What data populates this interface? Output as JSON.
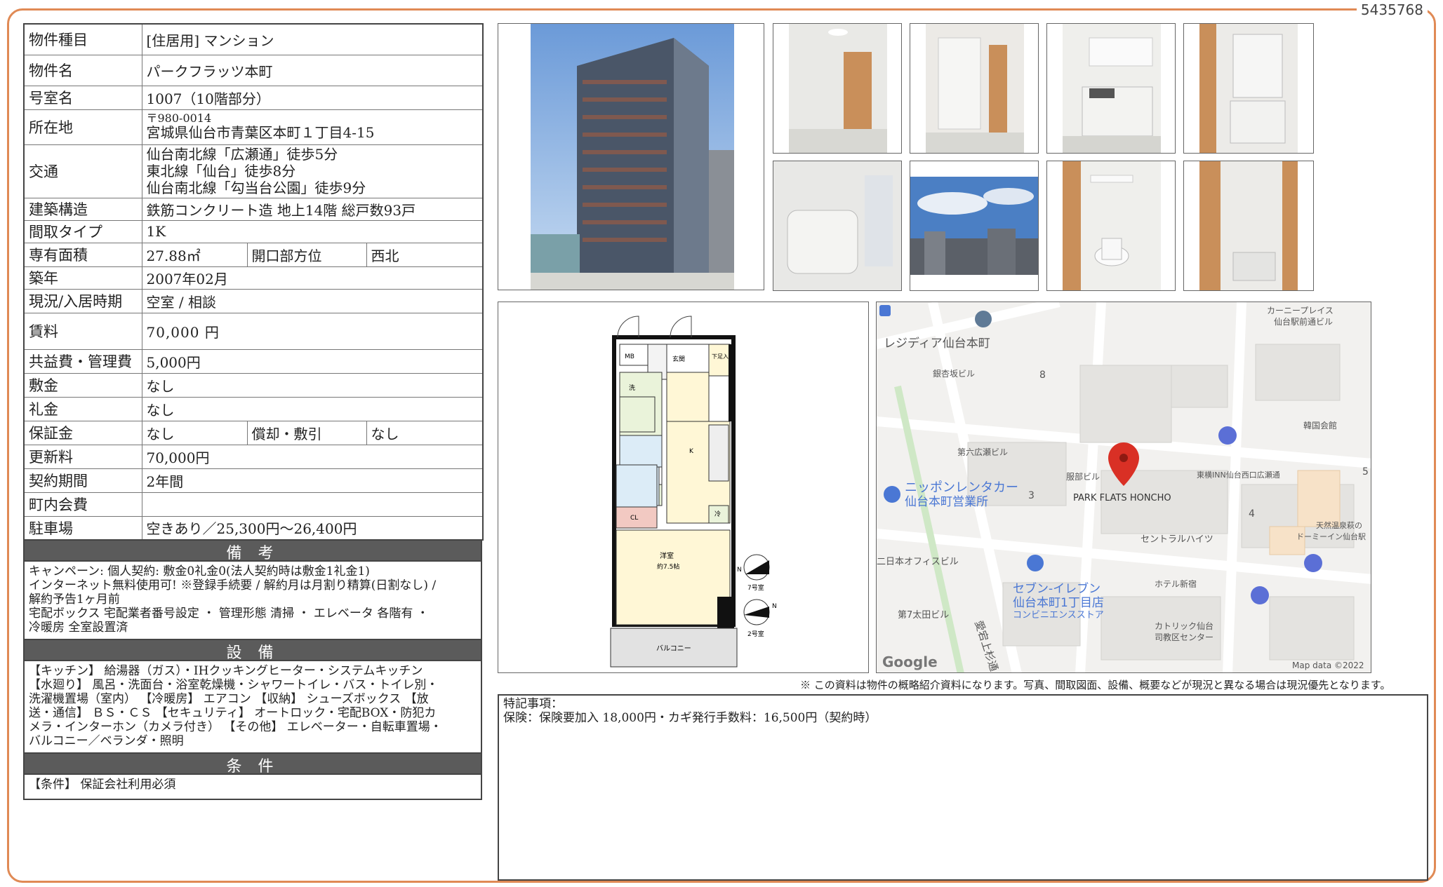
{
  "doc_number": "5435768",
  "spec": {
    "type_label": "物件種目",
    "type_value": "[住居用] マンション",
    "name_label": "物件名",
    "name_value": "パークフラッツ本町",
    "room_label": "号室名",
    "room_value": "1007（10階部分）",
    "address_label": "所在地",
    "postal": "〒980-0014",
    "address_value": "宮城県仙台市青葉区本町１丁目4-15",
    "traffic_label": "交通",
    "traffic_lines": [
      "仙台南北線「広瀬通」徒歩5分",
      "東北線「仙台」徒歩8分",
      "仙台南北線「勾当台公園」徒歩9分"
    ],
    "structure_label": "建築構造",
    "structure_value": "鉄筋コンクリート造 地上14階 総戸数93戸",
    "layout_label": "間取タイプ",
    "layout_value": "1K",
    "area_label": "専有面積",
    "area_value": "27.88㎡",
    "direction_label": "開口部方位",
    "direction_value": "西北",
    "built_label": "築年",
    "built_value": "2007年02月",
    "status_label": "現況/入居時期",
    "status_value": "空室 / 相談",
    "rent_label": "賃料",
    "rent_value": "70,000 円",
    "fee_label": "共益費・管理費",
    "fee_value": "5,000円",
    "deposit_label": "敷金",
    "deposit_value": "なし",
    "keymoney_label": "礼金",
    "keymoney_value": "なし",
    "guarantee_label": "保証金",
    "guarantee_value": "なし",
    "amort_label": "償却・敷引",
    "amort_value": "なし",
    "renewal_label": "更新料",
    "renewal_value": "70,000円",
    "term_label": "契約期間",
    "term_value": "2年間",
    "townfee_label": "町内会費",
    "townfee_value": "",
    "parking_label": "駐車場",
    "parking_value": "空きあり／25,300円〜26,400円"
  },
  "remarks": {
    "title": "備 考",
    "lines": [
      "キャンペーン: 個人契約: 敷金0礼金0(法人契約時は敷金1礼金1)",
      "インターネット無料使用可! ※登録手続要 / 解約月は月割り精算(日割なし) /",
      "解約予告1ヶ月前",
      "宅配ボックス 宅配業者番号設定 ・ 管理形態 清掃 ・ エレベータ 各階有 ・",
      "冷暖房 全室設置済"
    ]
  },
  "equipment": {
    "title": "設 備",
    "lines": [
      "【キッチン】 給湯器（ガス）・IHクッキングヒーター・システムキッチン",
      "【水廻り】 風呂・洗面台・浴室乾燥機・シャワートイレ・バス・トイレ別・",
      "洗濯機置場（室内） 【冷暖房】 エアコン 【収納】 シューズボックス 【放",
      "送・通信】 ＢＳ・ＣＳ 【セキュリティ】 オートロック・宅配BOX・防犯カ",
      "メラ・インターホン（カメラ付き） 【その他】 エレベーター・自転車置場・",
      "バルコニー／ベランダ・照明"
    ]
  },
  "conditions": {
    "title": "条 件",
    "text": "【条件】 保証会社利用必須"
  },
  "floorplan": {
    "labels": {
      "mb": "MB",
      "entrance": "玄関",
      "shoes": "下足入",
      "wash": "洗",
      "cl": "CL",
      "k": "K",
      "fridge": "冷",
      "room": "洋室",
      "room_size": "約7.5帖",
      "balcony": "バルコニー",
      "n1": "7号室",
      "n2": "2号室",
      "north": "N"
    }
  },
  "map": {
    "labels": [
      "レジディア仙台本町",
      "銀杏坂ビル",
      "第六広瀬ビル",
      "ニッポンレンタカー",
      "仙台本町営業所",
      "服部ビル",
      "PARK FLATS HONCHO",
      "東横INN仙台西口広瀬通",
      "セントラルハイツ",
      "カーニープレイス",
      "仙台駅前通ビル",
      "韓国会館",
      "天然温泉萩の",
      "ドーミーイン仙台駅",
      "二日本オフィスビル",
      "セブン-イレブン",
      "仙台本町1丁目店",
      "コンビニエンスストア",
      "ホテル新宿",
      "カトリック仙台",
      "司教区センター",
      "第7太田ビル",
      "愛宕上杉通",
      "Google",
      "Map data ©2022",
      "8",
      "3",
      "4",
      "5"
    ]
  },
  "disclaimer": "※ この資料は物件の概略紹介資料になります。写真、間取図面、設備、概要などが現況と異なる場合は現況優先となります。",
  "notes": {
    "heading": "特記事項：",
    "text": "保険：保険要加入 18,000円・カギ発行手数料：16,500円（契約時）"
  },
  "colors": {
    "frame": "#e08a55",
    "section_header": "#5b5b5b",
    "map_pin": "#d93025",
    "map_poi_blue": "#4a77d4",
    "map_parking": "#5b6fd6"
  }
}
